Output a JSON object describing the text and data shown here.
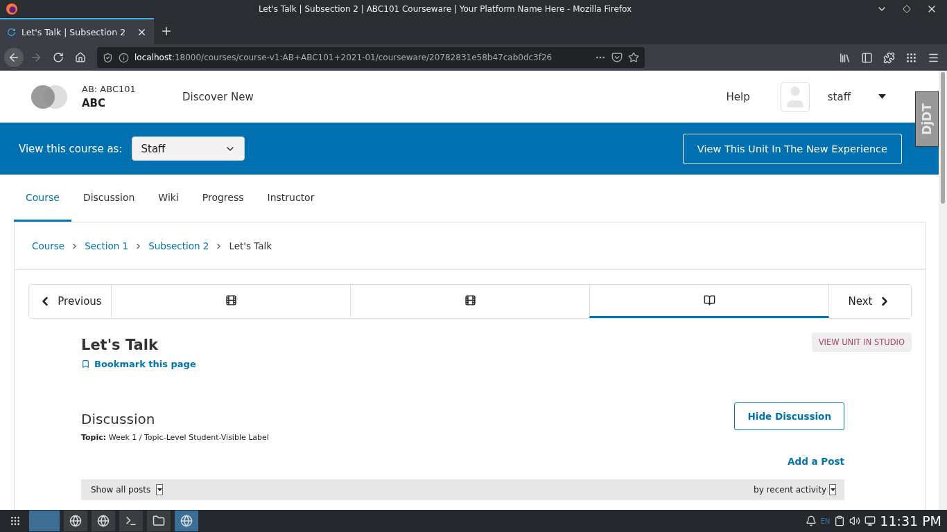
{
  "window": {
    "title": "Let's Talk | Subsection 2 | ABC101 Courseware | Your Platform Name Here - Mozilla Firefox"
  },
  "browser_tabs": [
    {
      "label": "Let's Talk | Subsection 2",
      "selected": true
    }
  ],
  "address_bar": {
    "host": "localhost",
    "path": ":18000/courses/course-v1:AB+ABC101+2021-01/courseware/20782831e58b47cab0dc3f26"
  },
  "header": {
    "course_org": "AB: ABC101",
    "course_name": "ABC",
    "nav_link": "Discover New",
    "help": "Help",
    "username": "staff"
  },
  "debug_toolbar": {
    "label": "DjDT"
  },
  "preview_bar": {
    "label": "View this course as:",
    "role": "Staff",
    "new_experience_button": "View This Unit In The New Experience"
  },
  "course_tabs": [
    {
      "label": "Course",
      "selected": true
    },
    {
      "label": "Discussion",
      "selected": false
    },
    {
      "label": "Wiki",
      "selected": false
    },
    {
      "label": "Progress",
      "selected": false
    },
    {
      "label": "Instructor",
      "selected": false
    }
  ],
  "breadcrumbs": [
    {
      "label": "Course",
      "link": true
    },
    {
      "label": "Section 1",
      "link": true
    },
    {
      "label": "Subsection 2",
      "link": true
    },
    {
      "label": "Let's Talk",
      "link": false
    }
  ],
  "sequence_nav": {
    "previous": "Previous",
    "next": "Next",
    "units": [
      {
        "kind": "video",
        "selected": false
      },
      {
        "kind": "video",
        "selected": false
      },
      {
        "kind": "other",
        "selected": true
      }
    ]
  },
  "unit": {
    "title": "Let's Talk",
    "bookmark": "Bookmark this page",
    "studio_button": "VIEW UNIT IN STUDIO"
  },
  "discussion": {
    "title": "Discussion",
    "topic": "**Topic:** Week 1 / Topic-Level Student-Visible Label",
    "hide_button": "Hide Discussion",
    "add_post": "Add a Post",
    "filter": "Show all posts",
    "sort": "by recent activity"
  },
  "taskbar": {
    "language": "EN",
    "clock": "11:31 PM"
  }
}
